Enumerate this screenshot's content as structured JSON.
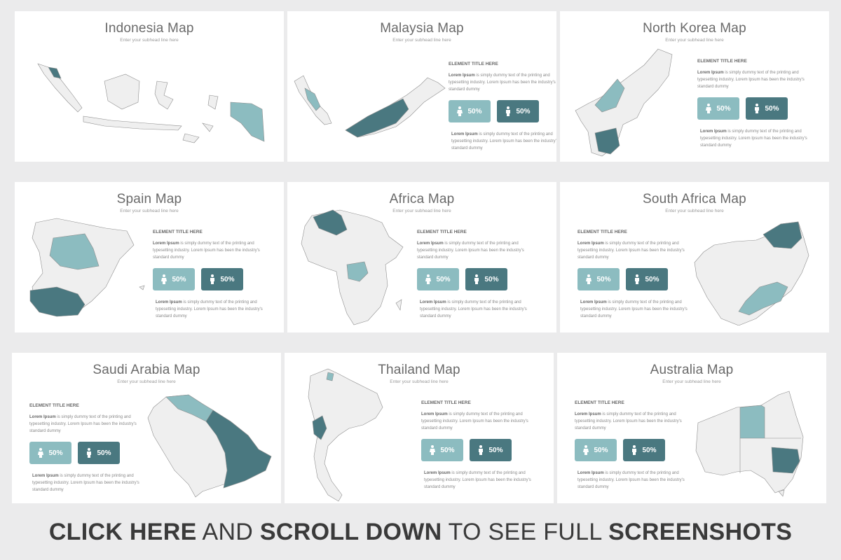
{
  "slides": [
    {
      "title": "Indonesia Map",
      "subhead": "Enter your subhead line here"
    },
    {
      "title": "Malaysia Map",
      "subhead": "Enter your subhead line here"
    },
    {
      "title": "North Korea Map",
      "subhead": "Enter your subhead line here"
    },
    {
      "title": "Spain Map",
      "subhead": "Enter your subhead line here"
    },
    {
      "title": "Africa Map",
      "subhead": "Enter your subhead line here"
    },
    {
      "title": "South Africa Map",
      "subhead": "Enter your subhead line here"
    },
    {
      "title": "Saudi Arabia Map",
      "subhead": "Enter your subhead line here"
    },
    {
      "title": "Thailand Map",
      "subhead": "Enter your subhead line here"
    },
    {
      "title": "Australia Map",
      "subhead": "Enter your subhead line here"
    }
  ],
  "panel": {
    "element_title": "ELEMENT TITLE HERE",
    "lorem_bold": "Lorem Ipsum",
    "lorem_text": " is simply dummy text of the printing and typesetting industry. Lorem Ipsum has been the industry's standard dummy",
    "stat_female": "50%",
    "stat_male": "50%"
  },
  "banner": {
    "part1": "CLICK HERE",
    "part2": " AND ",
    "part3": "SCROLL DOWN",
    "part4": " TO SEE FULL ",
    "part5": "SCREENSHOTS"
  },
  "colors": {
    "light_teal": "#8cbcc0",
    "dark_teal": "#4a7880",
    "map_fill": "#efefef",
    "background": "#ebebec"
  },
  "icons": {
    "female": "female-icon",
    "male": "male-icon"
  }
}
